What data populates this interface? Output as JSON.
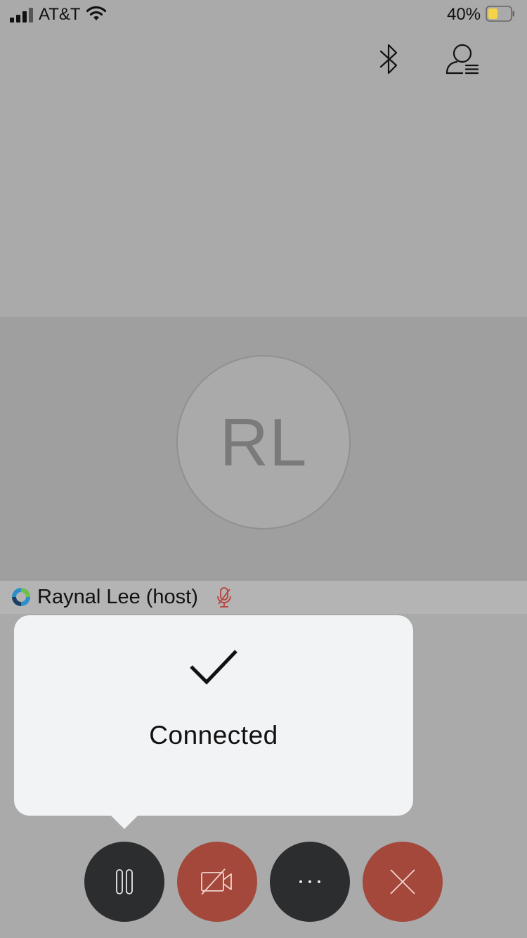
{
  "status_bar": {
    "carrier": "AT&T",
    "battery_percent": "40%",
    "battery_fill_color": "#f5d547"
  },
  "header": {
    "icons": [
      "bluetooth-icon",
      "participants-icon"
    ]
  },
  "participant": {
    "initials": "RL",
    "name": "Raynal Lee (host)",
    "audio_status": "muted"
  },
  "toast": {
    "icon": "checkmark-icon",
    "message": "Connected"
  },
  "controls": [
    {
      "name": "hold",
      "icon": "pause-icon",
      "color": "#2b2d2f"
    },
    {
      "name": "video",
      "icon": "video-off-icon",
      "color": "#a3483b"
    },
    {
      "name": "more",
      "icon": "more-icon",
      "color": "#2b2d2f"
    },
    {
      "name": "end-call",
      "icon": "close-icon",
      "color": "#a3483b"
    }
  ],
  "colors": {
    "background": "#a9aaa9",
    "video_area": "#9f9f9f",
    "muted_mic": "#b8413a"
  }
}
